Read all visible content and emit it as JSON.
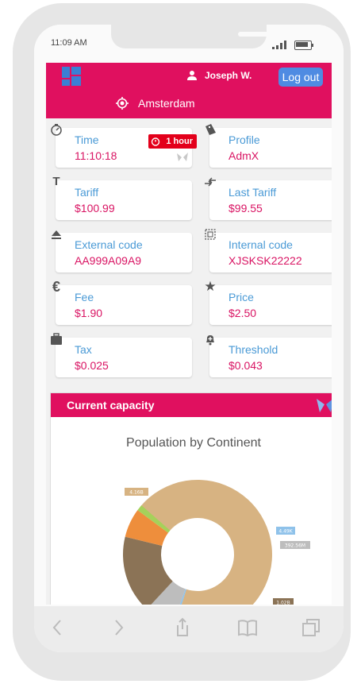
{
  "status_bar": {
    "time": "11:09 AM"
  },
  "header": {
    "user_name": "Joseph W.",
    "logout_label": "Log out",
    "location": "Amsterdam"
  },
  "tiles": [
    {
      "label": "Time",
      "value": "11:10:18",
      "icon": "stopwatch-icon",
      "badge": "1 hour"
    },
    {
      "label": "Profile",
      "value": "AdmX",
      "icon": "tag-icon"
    },
    {
      "label": "Tariff",
      "value": "$100.99",
      "icon": "text-t-icon"
    },
    {
      "label": "Last Tariff",
      "value": "$99.55",
      "icon": "swap-arrows-icon"
    },
    {
      "label": "External code",
      "value": "AA999A09A9",
      "icon": "eject-icon"
    },
    {
      "label": "Internal code",
      "value": "XJSKSK22222",
      "icon": "dashed-square-icon"
    },
    {
      "label": "Fee",
      "value": "$1.90",
      "icon": "euro-icon"
    },
    {
      "label": "Price",
      "value": "$2.50",
      "icon": "star-icon"
    },
    {
      "label": "Tax",
      "value": "$0.025",
      "icon": "briefcase-icon"
    },
    {
      "label": "Threshold",
      "value": "$0.043",
      "icon": "bell-plus-icon"
    }
  ],
  "capacity_card": {
    "title": "Current capacity"
  },
  "colors": {
    "brand": "#e0105f",
    "accent": "#4f8be2",
    "label": "#4a9ad6",
    "value": "#d91463",
    "badge": "#e3001b"
  },
  "chart_data": {
    "type": "pie",
    "title": "Population by Continent",
    "donut": true,
    "slices": [
      {
        "label": "4.16B",
        "value": 4.16,
        "color": "#d7b382"
      },
      {
        "label": "4.49K",
        "value": 0.002,
        "color": "#8fc2ea"
      },
      {
        "label": "392.56M",
        "value": 0.3926,
        "color": "#bdbdbd"
      },
      {
        "label": "1.02B",
        "value": 1.02,
        "color": "#8b7356"
      },
      {
        "label": "",
        "value": 0.38,
        "color": "#ee8e3c"
      },
      {
        "label": "",
        "value": 0.08,
        "color": "#a5d15a"
      }
    ]
  }
}
